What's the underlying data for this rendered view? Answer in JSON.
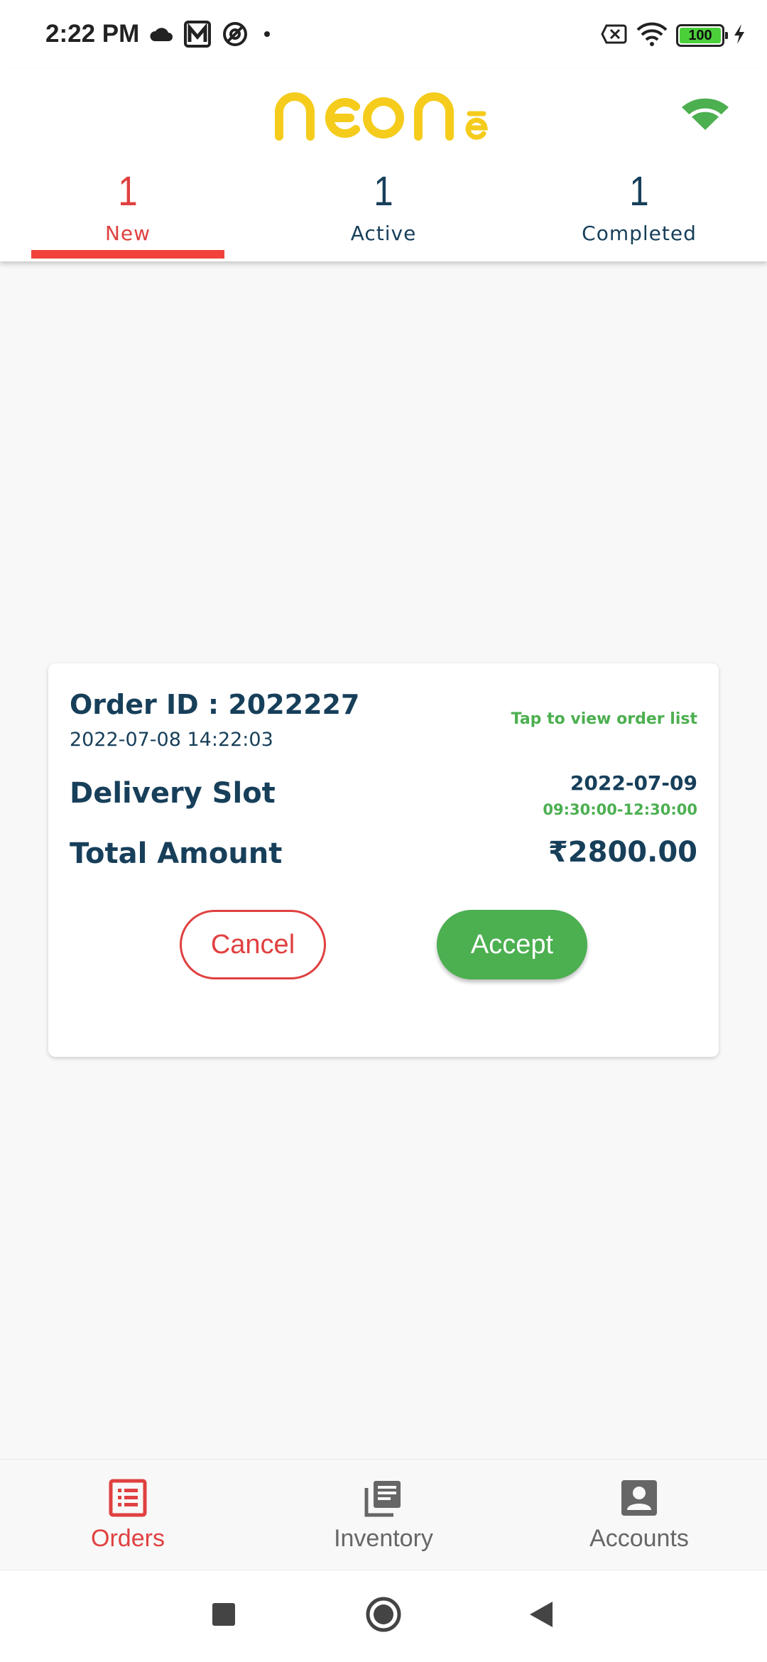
{
  "status_bar": {
    "time": "2:22 PM",
    "battery_level": "100",
    "left_icons": [
      "cloud-icon",
      "m-app-icon",
      "at-sign-icon",
      "dot-icon"
    ],
    "right_icons": [
      "no-sim-icon",
      "wifi-icon",
      "battery-icon",
      "charging-icon"
    ]
  },
  "header": {
    "logo_text": "NEONē",
    "logo_color": "#f5cc1c",
    "connection_icon": "wifi-connected-icon",
    "connection_color": "#4caf50"
  },
  "tabs": [
    {
      "count": "1",
      "label": "New",
      "active": true
    },
    {
      "count": "1",
      "label": "Active",
      "active": false
    },
    {
      "count": "1",
      "label": "Completed",
      "active": false
    }
  ],
  "order": {
    "id_text": "Order ID : 2022227",
    "datetime": "2022-07-08 14:22:03",
    "view_link": "Tap to view order list",
    "slot_label": "Delivery Slot",
    "slot_date": "2022-07-09",
    "slot_time": "09:30:00-12:30:00",
    "total_label": "Total Amount",
    "total_value": "₹2800.00",
    "cancel_label": "Cancel",
    "accept_label": "Accept"
  },
  "bottom_nav": [
    {
      "label": "Orders",
      "icon": "orders-list-icon",
      "active": true
    },
    {
      "label": "Inventory",
      "icon": "inventory-icon",
      "active": false
    },
    {
      "label": "Accounts",
      "icon": "account-icon",
      "active": false
    }
  ],
  "colors": {
    "accent_red": "#e04040",
    "accent_green": "#4caf50",
    "text_navy": "#173f5a",
    "logo_yellow": "#f5cc1c"
  }
}
